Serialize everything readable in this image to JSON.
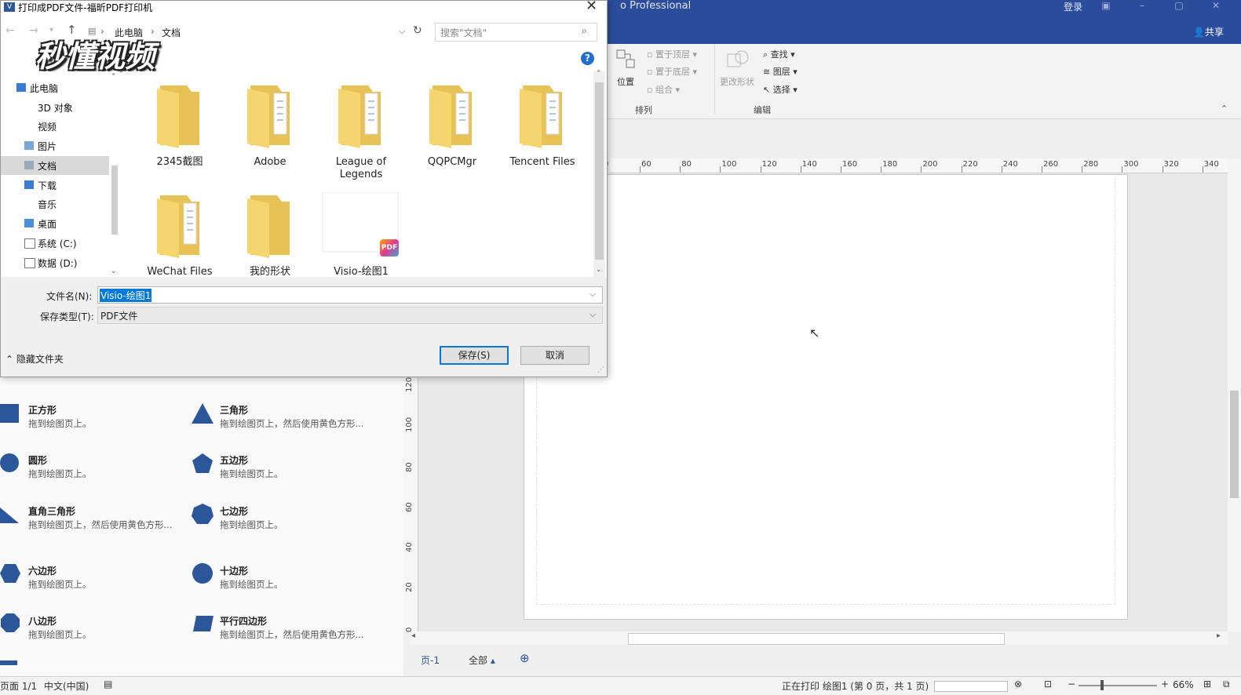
{
  "visio": {
    "title": "o Professional",
    "login": "登录",
    "share": "共享",
    "ribbon": {
      "position": "位置",
      "bring_front": "置于顶层",
      "send_back": "置于底层",
      "group": "组合",
      "change_shape": "更改形状",
      "find": "查找",
      "layers": "图层",
      "select": "选择",
      "group_arrange": "排列",
      "group_edit": "编辑"
    },
    "ruler_h": [
      "0",
      "60",
      "80",
      "100",
      "120",
      "140",
      "160",
      "180",
      "200",
      "220",
      "240",
      "260",
      "280",
      "300",
      "320",
      "340"
    ],
    "ruler_v": [
      "120",
      "100",
      "80",
      "60",
      "40",
      "20",
      "0"
    ],
    "page_tab": "页-1",
    "all_tab": "全部",
    "status": {
      "page": "页面 1/1",
      "lang": "中文(中国)",
      "printing": "正在打印 绘图1 (第 0 页，共 1 页)",
      "zoom": "66%"
    },
    "shapes": [
      {
        "name": "正方形",
        "desc": "拖到绘图页上。",
        "icon": "square"
      },
      {
        "name": "三角形",
        "desc": "拖到绘图页上，然后使用黄色方形...",
        "icon": "triangle"
      },
      {
        "name": "圆形",
        "desc": "拖到绘图页上。",
        "icon": "circle"
      },
      {
        "name": "五边形",
        "desc": "拖到绘图页上。",
        "icon": "pentagon"
      },
      {
        "name": "直角三角形",
        "desc": "拖到绘图页上，然后使用黄色方形...",
        "icon": "right-triangle"
      },
      {
        "name": "七边形",
        "desc": "拖到绘图页上。",
        "icon": "heptagon"
      },
      {
        "name": "六边形",
        "desc": "拖到绘图页上。",
        "icon": "hexagon"
      },
      {
        "name": "十边形",
        "desc": "拖到绘图页上。",
        "icon": "decagon"
      },
      {
        "name": "八边形",
        "desc": "拖到绘图页上。",
        "icon": "octagon"
      },
      {
        "name": "平行四边形",
        "desc": "拖到绘图页上，然后使用黄色方形...",
        "icon": "parallelogram"
      }
    ]
  },
  "dialog": {
    "title": "打印成PDF文件-福昕PDF打印机",
    "breadcrumb": [
      "此电脑",
      "文档"
    ],
    "search_placeholder": "搜索\"文档\"",
    "logo": "秒懂视频",
    "nav": [
      {
        "label": "此电脑",
        "icon": "pc"
      },
      {
        "label": "3D 对象",
        "icon": "3d"
      },
      {
        "label": "视频",
        "icon": "video"
      },
      {
        "label": "图片",
        "icon": "pictures"
      },
      {
        "label": "文档",
        "icon": "documents"
      },
      {
        "label": "下载",
        "icon": "downloads"
      },
      {
        "label": "音乐",
        "icon": "music"
      },
      {
        "label": "桌面",
        "icon": "desktop"
      },
      {
        "label": "系统 (C:)",
        "icon": "drive"
      },
      {
        "label": "数据 (D:)",
        "icon": "drive"
      }
    ],
    "files": [
      {
        "name": "2345截图",
        "type": "folder-plain"
      },
      {
        "name": "Adobe",
        "type": "folder-docs"
      },
      {
        "name": "League of Legends",
        "type": "folder-docs"
      },
      {
        "name": "QQPCMgr",
        "type": "folder-docs"
      },
      {
        "name": "Tencent Files",
        "type": "folder-docs"
      },
      {
        "name": "WeChat Files",
        "type": "folder-docs"
      },
      {
        "name": "我的形状",
        "type": "folder-plain"
      },
      {
        "name": "Visio-绘图1",
        "type": "pdf-file"
      }
    ],
    "filename_label": "文件名(N):",
    "filename_value": "Visio-绘图1",
    "filetype_label": "保存类型(T):",
    "filetype_value": "PDF文件",
    "hide_folders": "隐藏文件夹",
    "save_button": "保存(S)",
    "cancel_button": "取消",
    "pdf_badge": "PDF"
  }
}
